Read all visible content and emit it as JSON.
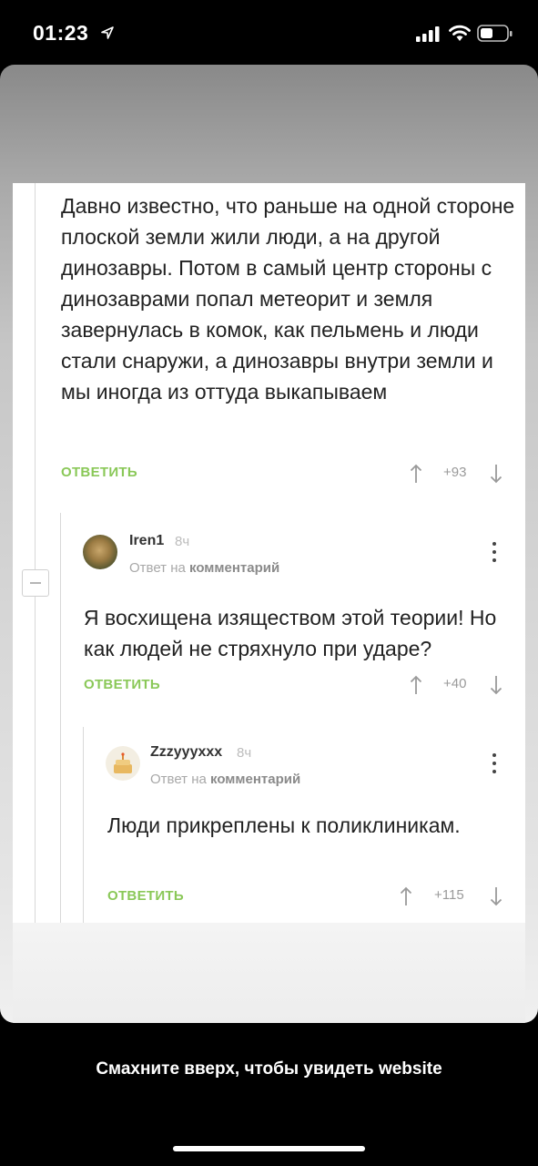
{
  "status_bar": {
    "time": "01:23",
    "icons": [
      "location-arrow-icon",
      "cellular-signal-icon",
      "wifi-icon",
      "battery-icon"
    ]
  },
  "comments": [
    {
      "text": "Давно известно, что раньше на одной стороне плоской земли жили люди, а на другой динозавры. Потом в самый центр стороны с динозаврами попал метеорит и земля завернулась в комок, как пельмень и люди стали снаружи, а динозавры внутри земли и мы иногда из оттуда выкапываем",
      "reply_label": "ОТВЕТИТЬ",
      "score": "+93"
    },
    {
      "username": "Iren1",
      "time_ago": "8ч",
      "reply_to_prefix": "Ответ на",
      "reply_to_link": "комментарий",
      "text": "Я восхищена изяществом этой теории! Но как людей не стряхнуло при ударе?",
      "reply_label": "ОТВЕТИТЬ",
      "score": "+40"
    },
    {
      "username": "Zzzyyyxxx",
      "time_ago": "8ч",
      "reply_to_prefix": "Ответ на",
      "reply_to_link": "комментарий",
      "text": "Люди прикреплены к поликлиникам.",
      "reply_label": "ОТВЕТИТЬ",
      "score": "+115"
    }
  ],
  "swipe_hint": "Смахните вверх, чтобы увидеть website",
  "colors": {
    "accent_green": "#8ac858",
    "text": "#222222",
    "muted": "#9a9a9a"
  }
}
